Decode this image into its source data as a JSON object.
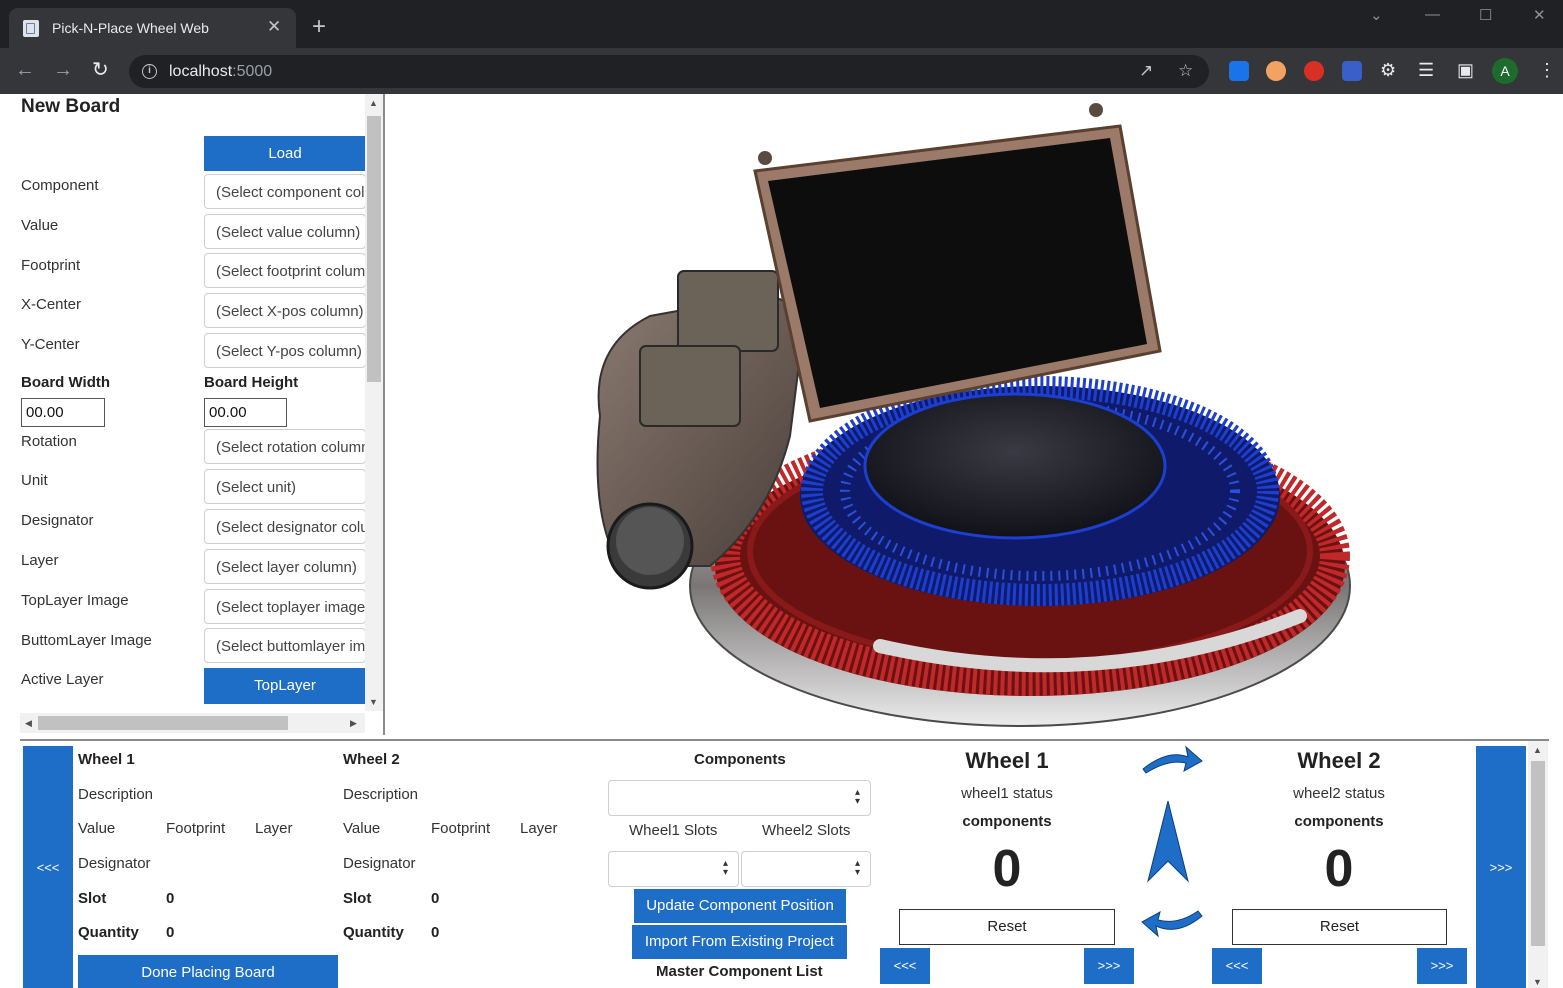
{
  "browser": {
    "tab_title": "Pick-N-Place Wheel Web",
    "tab_close": "✕",
    "new_tab": "+",
    "url_host": "localhost",
    "url_port": ":5000",
    "avatar_letter": "A"
  },
  "left_panel": {
    "title": "New Board",
    "load_button": "Load",
    "fields": [
      {
        "label": "Component",
        "placeholder": "(Select component column)"
      },
      {
        "label": "Value",
        "placeholder": "(Select value column)"
      },
      {
        "label": "Footprint",
        "placeholder": "(Select footprint column)"
      },
      {
        "label": "X-Center",
        "placeholder": "(Select X-pos column)"
      },
      {
        "label": "Y-Center",
        "placeholder": "(Select Y-pos column)"
      }
    ],
    "board_width_label": "Board Width",
    "board_height_label": "Board Height",
    "board_width_value": "00.00",
    "board_height_value": "00.00",
    "fields2": [
      {
        "label": "Rotation",
        "placeholder": "(Select rotation column)"
      },
      {
        "label": "Unit",
        "placeholder": "(Select unit)"
      },
      {
        "label": "Designator",
        "placeholder": "(Select designator column)"
      },
      {
        "label": "Layer",
        "placeholder": "(Select layer column)"
      },
      {
        "label": "TopLayer Image",
        "placeholder": "(Select toplayer image)"
      },
      {
        "label": "ButtomLayer Image",
        "placeholder": "(Select buttomlayer image)"
      }
    ],
    "active_layer_label": "Active Layer",
    "active_layer_button": "TopLayer"
  },
  "bottom": {
    "left_nav": "<<<",
    "right_nav": ">>>",
    "wheel1": {
      "title": "Wheel 1",
      "description": "Description",
      "value": "Value",
      "footprint": "Footprint",
      "layer": "Layer",
      "designator": "Designator",
      "slot_label": "Slot",
      "slot_value": "0",
      "quantity_label": "Quantity",
      "quantity_value": "0"
    },
    "wheel2": {
      "title": "Wheel 2",
      "description": "Description",
      "value": "Value",
      "footprint": "Footprint",
      "layer": "Layer",
      "designator": "Designator",
      "slot_label": "Slot",
      "slot_value": "0",
      "quantity_label": "Quantity",
      "quantity_value": "0"
    },
    "done_button": "Done Placing Board",
    "components": {
      "title": "Components",
      "wheel1_slots": "Wheel1 Slots",
      "wheel2_slots": "Wheel2 Slots",
      "update_button": "Update Component Position",
      "import_button": "Import From Existing Project",
      "master_list": "Master Component List"
    },
    "status1": {
      "title": "Wheel 1",
      "status": "wheel1 status",
      "components": "components",
      "count": "0",
      "reset": "Reset",
      "prev": "<<<",
      "next": ">>>"
    },
    "status2": {
      "title": "Wheel 2",
      "status": "wheel2 status",
      "components": "components",
      "count": "0",
      "reset": "Reset",
      "prev": "<<<",
      "next": ">>>"
    }
  },
  "colors": {
    "accent_blue": "#1e6ec8",
    "wheel_red": "#c0282a",
    "wheel_blue": "#1d3fd0"
  }
}
